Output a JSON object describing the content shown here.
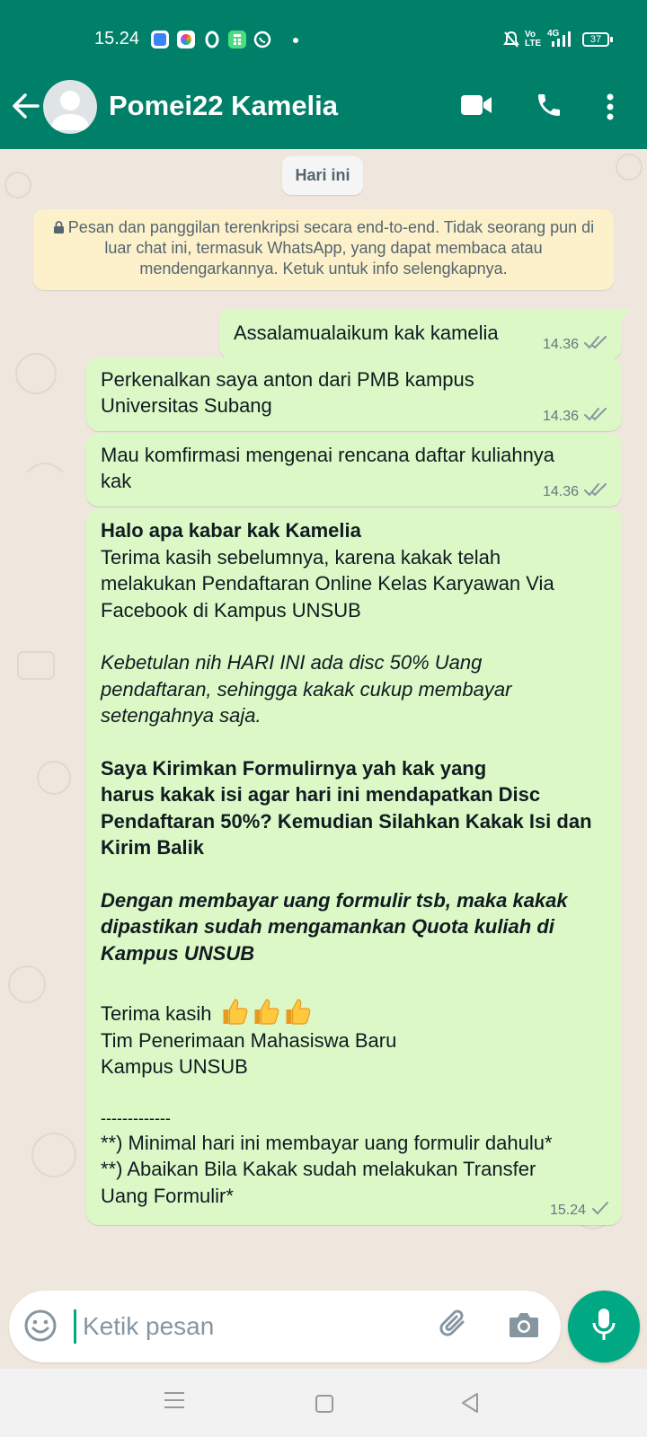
{
  "status_bar": {
    "time": "15.24",
    "battery": "37",
    "network": "4G",
    "volte": "Vo LTE"
  },
  "header": {
    "contact_name": "Pomei22 Kamelia"
  },
  "chat": {
    "date_chip": "Hari ini",
    "encryption_notice": "Pesan dan panggilan terenkripsi secara end-to-end. Tidak seorang pun di luar chat ini, termasuk WhatsApp, yang dapat membaca atau mendengarkannya. Ketuk untuk info selengkapnya.",
    "messages": [
      {
        "text": "Assalamualaikum kak kamelia",
        "time": "14.36",
        "status": "read"
      },
      {
        "line1": "Perkenalkan saya anton dari PMB kampus",
        "line2": "Universitas Subang",
        "time": "14.36",
        "status": "read"
      },
      {
        "line1": "Mau komfirmasi mengenai rencana daftar kuliahnya",
        "line2": "kak",
        "time": "14.36",
        "status": "read"
      },
      {
        "greeting": "Halo apa kabar kak Kamelia",
        "p1": [
          "Terima kasih sebelumnya, karena kakak telah",
          "melakukan Pendaftaran Online Kelas Karyawan Via",
          "Facebook di Kampus UNSUB"
        ],
        "p2": [
          "Kebetulan nih HARI INI ada disc 50% Uang",
          "pendaftaran, sehingga kakak cukup membayar",
          "setengahnya saja."
        ],
        "p3": [
          "Saya Kirimkan Formulirnya yah kak yang",
          "harus kakak isi agar hari ini mendapatkan Disc",
          "Pendaftaran 50%? Kemudian Silahkan Kakak Isi dan",
          "Kirim Balik"
        ],
        "p4": [
          "Dengan membayar uang formulir tsb, maka kakak",
          "dipastikan sudah mengamankan Quota kuliah di",
          "Kampus UNSUB"
        ],
        "thanks": "Terima kasih",
        "sign1": "Tim Penerimaan Mahasiswa Baru",
        "sign2": "Kampus UNSUB",
        "divider": "-------------",
        "note1": "**) Minimal hari ini membayar uang formulir dahulu*",
        "note2a": "**) Abaikan Bila Kakak sudah melakukan Transfer",
        "note2b": "Uang Formulir*",
        "time": "15.24",
        "status": "sent"
      }
    ]
  },
  "composer": {
    "placeholder": "Ketik pesan"
  },
  "colors": {
    "header": "#008069",
    "bubble_out": "#dcf8c6",
    "accent": "#00a884",
    "read_tick": "#8696a0"
  },
  "icons": [
    "back-arrow-icon",
    "avatar-placeholder-icon",
    "video-call-icon",
    "voice-call-icon",
    "more-vert-icon",
    "lock-icon",
    "double-check-icon",
    "single-check-icon",
    "emoji-icon",
    "attach-icon",
    "camera-icon",
    "mic-icon",
    "nav-menu-icon",
    "nav-home-icon",
    "nav-back-icon"
  ]
}
